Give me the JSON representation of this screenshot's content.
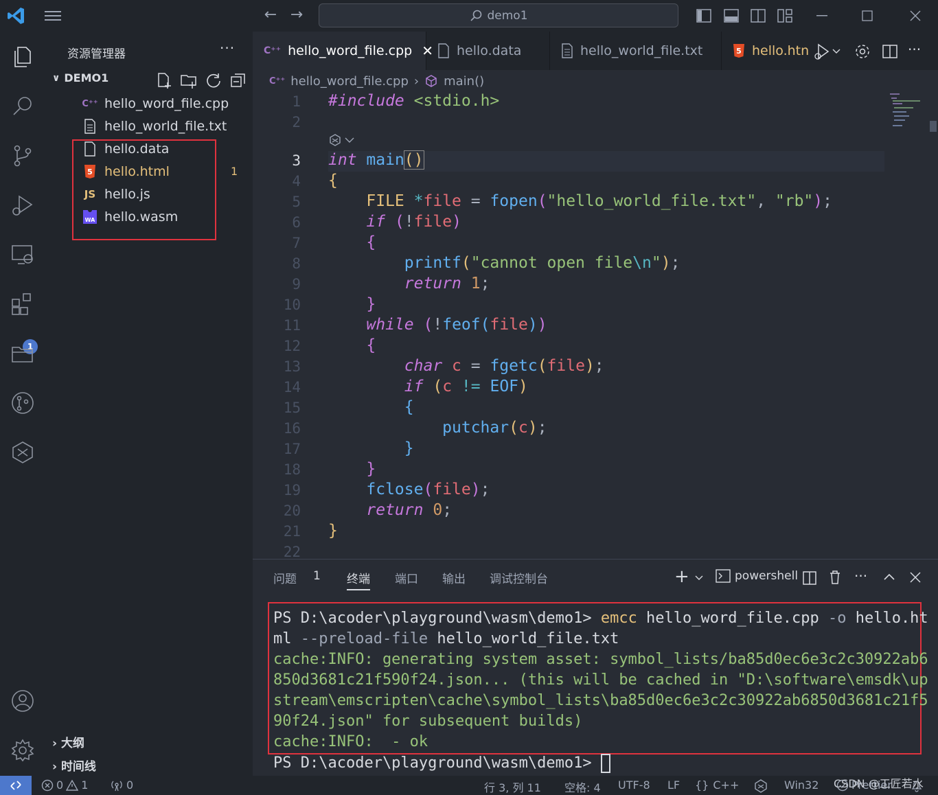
{
  "title": {
    "search": "demo1"
  },
  "sidebar": {
    "title": "资源管理器",
    "folder": "DEMO1",
    "files": [
      {
        "name": "hello_word_file.cpp",
        "icon": "cpp-icon"
      },
      {
        "name": "hello_world_file.txt",
        "icon": "text-file-icon"
      },
      {
        "name": "hello.data",
        "icon": "file-icon"
      },
      {
        "name": "hello.html",
        "icon": "html5-icon",
        "badge": "1"
      },
      {
        "name": "hello.js",
        "icon": "js-icon"
      },
      {
        "name": "hello.wasm",
        "icon": "wasm-icon"
      }
    ],
    "outline": "大纲",
    "timeline": "时间线"
  },
  "activity": {
    "extensions_badge": "1"
  },
  "tabs": [
    {
      "label": "hello_word_file.cpp",
      "active": true
    },
    {
      "label": "hello.data",
      "active": false
    },
    {
      "label": "hello_world_file.txt",
      "active": false
    },
    {
      "label": "hello.htn",
      "active": false
    }
  ],
  "breadcrumb": {
    "file": "hello_word_file.cpp",
    "symbol": "main()"
  },
  "editor": {
    "line_numbers": [
      "1",
      "2",
      "3",
      "4",
      "5",
      "6",
      "7",
      "8",
      "9",
      "10",
      "11",
      "12",
      "13",
      "14",
      "15",
      "16",
      "17",
      "18",
      "19",
      "20",
      "21",
      "22"
    ],
    "current_line": "3"
  },
  "panel": {
    "tabs": [
      "问题",
      "1",
      "终端",
      "端口",
      "输出",
      "调试控制台"
    ],
    "shell": "powershell",
    "terminal": {
      "prompt": "PS D:\\acoder\\playground\\wasm\\demo1> ",
      "cmd": "emcc",
      "arg1": " hello_word_file.cpp ",
      "flag1": "-o",
      "arg2": " hello.ht",
      "line2a": "ml ",
      "flag2": "--preload-file",
      "arg3": " hello_world_file.txt",
      "info1": "cache:INFO: generating system asset: symbol_lists/ba85d0ec6e3c2c30922ab6",
      "info2": "850d3681c21f590f24.json... (this will be cached in \"D:\\software\\emsdk\\up",
      "info3": "stream\\emscripten\\cache\\symbol_lists\\ba85d0ec6e3c2c30922ab6850d3681c21f5",
      "info4": "90f24.json\" for subsequent builds)",
      "info5": "cache:INFO:  - ok",
      "prompt2": "PS D:\\acoder\\playground\\wasm\\demo1> "
    }
  },
  "status": {
    "errors": "0",
    "warnings": "1",
    "ports": "0",
    "position": "行 3, 列 11",
    "spaces": "空格: 4",
    "encoding": "UTF-8",
    "eol": "LF",
    "language": "C++",
    "platform": "Win32",
    "formatter": "Prettier",
    "watermark": "CSDN @工匠若水"
  },
  "colors": {
    "accent": "#4d78cc",
    "annotation": "#e0323e"
  }
}
